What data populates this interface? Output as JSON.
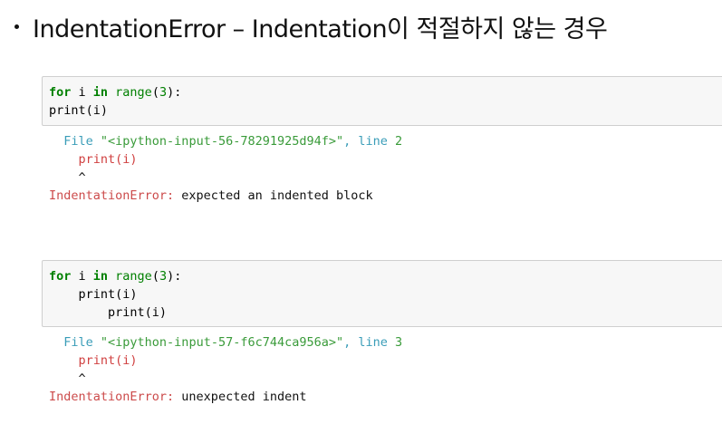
{
  "heading": {
    "text": "IndentationError – Indentation이 적절하지 않는 경우"
  },
  "examples": [
    {
      "code": {
        "line1_kw_for": "for",
        "line1_var": " i ",
        "line1_kw_in": "in",
        "line1_fn": " range",
        "line1_open": "(",
        "line1_num": "3",
        "line1_close": "):",
        "line2": "print(i)"
      },
      "traceback": {
        "file_prefix": "  File ",
        "file_path": "\"<ipython-input-56-78291925d94f>\"",
        "line_label": ", line ",
        "line_number": "2",
        "source_line": "    print(i)",
        "caret": "    ^",
        "error_name": "IndentationError:",
        "error_message": " expected an indented block"
      }
    },
    {
      "code": {
        "line1_kw_for": "for",
        "line1_var": " i ",
        "line1_kw_in": "in",
        "line1_fn": " range",
        "line1_open": "(",
        "line1_num": "3",
        "line1_close": "):",
        "line2": "    print(i)",
        "line3": "        print(i)"
      },
      "traceback": {
        "file_prefix": "  File ",
        "file_path": "\"<ipython-input-57-f6c744ca956a>\"",
        "line_label": ", line ",
        "line_number": "3",
        "source_line": "    print(i)",
        "caret": "    ^",
        "error_name": "IndentationError:",
        "error_message": " unexpected indent"
      }
    }
  ],
  "colors": {
    "keyword": "#008000",
    "file_label": "#3a9db8",
    "file_path": "#3a9b3a",
    "error": "#cc4b4b",
    "cell_bg": "#f7f7f7",
    "cell_border": "#cfcfcf"
  }
}
